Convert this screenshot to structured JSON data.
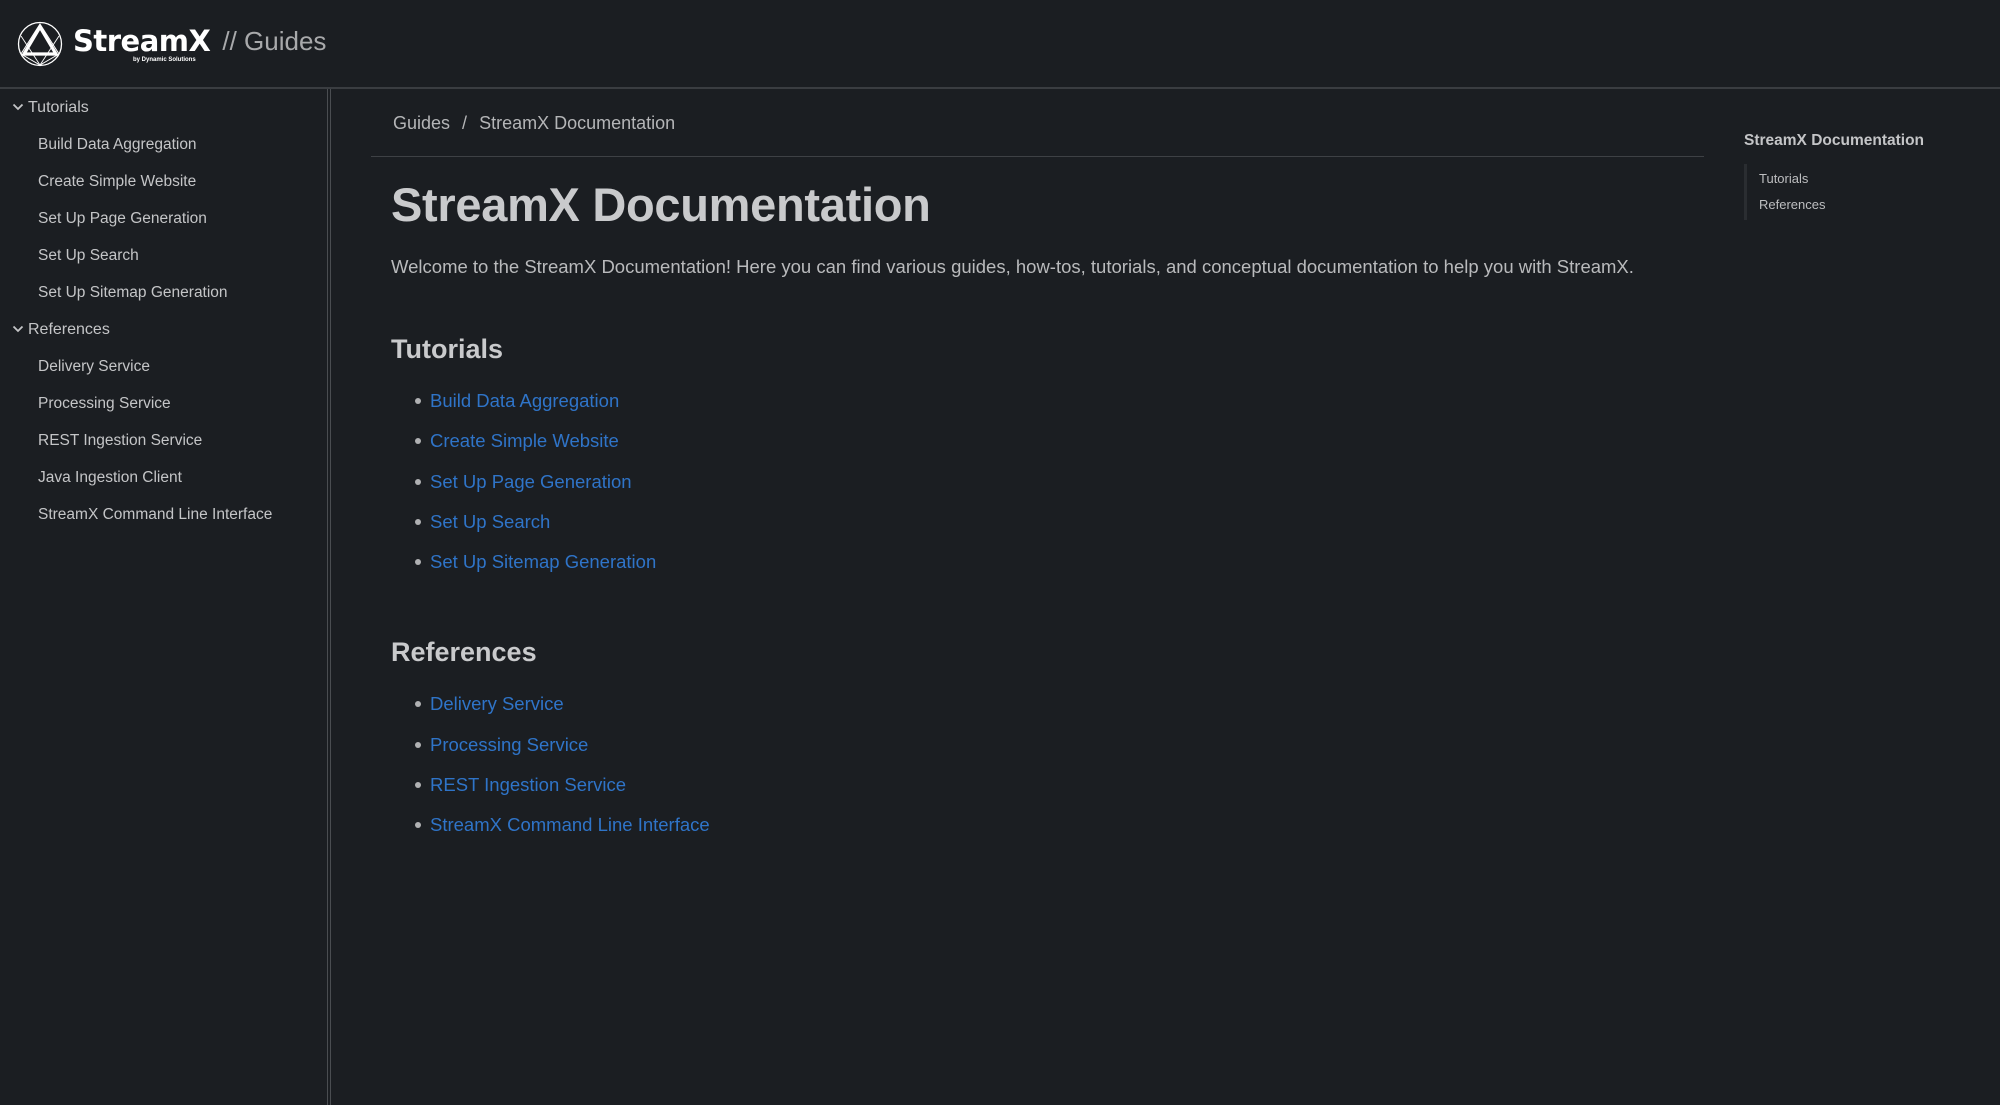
{
  "header": {
    "brand_name": "StreamX",
    "brand_subtitle": "by Dynamic Solutions",
    "brand_suffix": "// Guides",
    "logo_icon": "triangle-in-circle-logo"
  },
  "sidebar": {
    "groups": [
      {
        "label": "Tutorials",
        "expanded": true,
        "icon": "chevron-down-icon",
        "items": [
          {
            "label": "Build Data Aggregation"
          },
          {
            "label": "Create Simple Website"
          },
          {
            "label": "Set Up Page Generation"
          },
          {
            "label": "Set Up Search"
          },
          {
            "label": "Set Up Sitemap Generation"
          }
        ]
      },
      {
        "label": "References",
        "expanded": true,
        "icon": "chevron-down-icon",
        "items": [
          {
            "label": "Delivery Service"
          },
          {
            "label": "Processing Service"
          },
          {
            "label": "REST Ingestion Service"
          },
          {
            "label": "Java Ingestion Client"
          },
          {
            "label": "StreamX Command Line Interface"
          }
        ]
      }
    ]
  },
  "breadcrumb": {
    "items": [
      "Guides",
      "StreamX Documentation"
    ],
    "separator": "/"
  },
  "main": {
    "title": "StreamX Documentation",
    "intro": "Welcome to the StreamX Documentation! Here you can find various guides, how-tos, tutorials, and conceptual documentation to help you with StreamX.",
    "sections": [
      {
        "title": "Tutorials",
        "links": [
          "Build Data Aggregation",
          "Create Simple Website",
          "Set Up Page Generation",
          "Set Up Search",
          "Set Up Sitemap Generation"
        ]
      },
      {
        "title": "References",
        "links": [
          "Delivery Service",
          "Processing Service",
          "REST Ingestion Service",
          "StreamX Command Line Interface"
        ]
      }
    ]
  },
  "toc": {
    "title": "StreamX Documentation",
    "items": [
      "Tutorials",
      "References"
    ]
  },
  "colors": {
    "background": "#1b1e22",
    "link": "#2f74c8",
    "heading": "#c9cacc",
    "text": "#b9babc",
    "divider": "#3a3d41"
  }
}
